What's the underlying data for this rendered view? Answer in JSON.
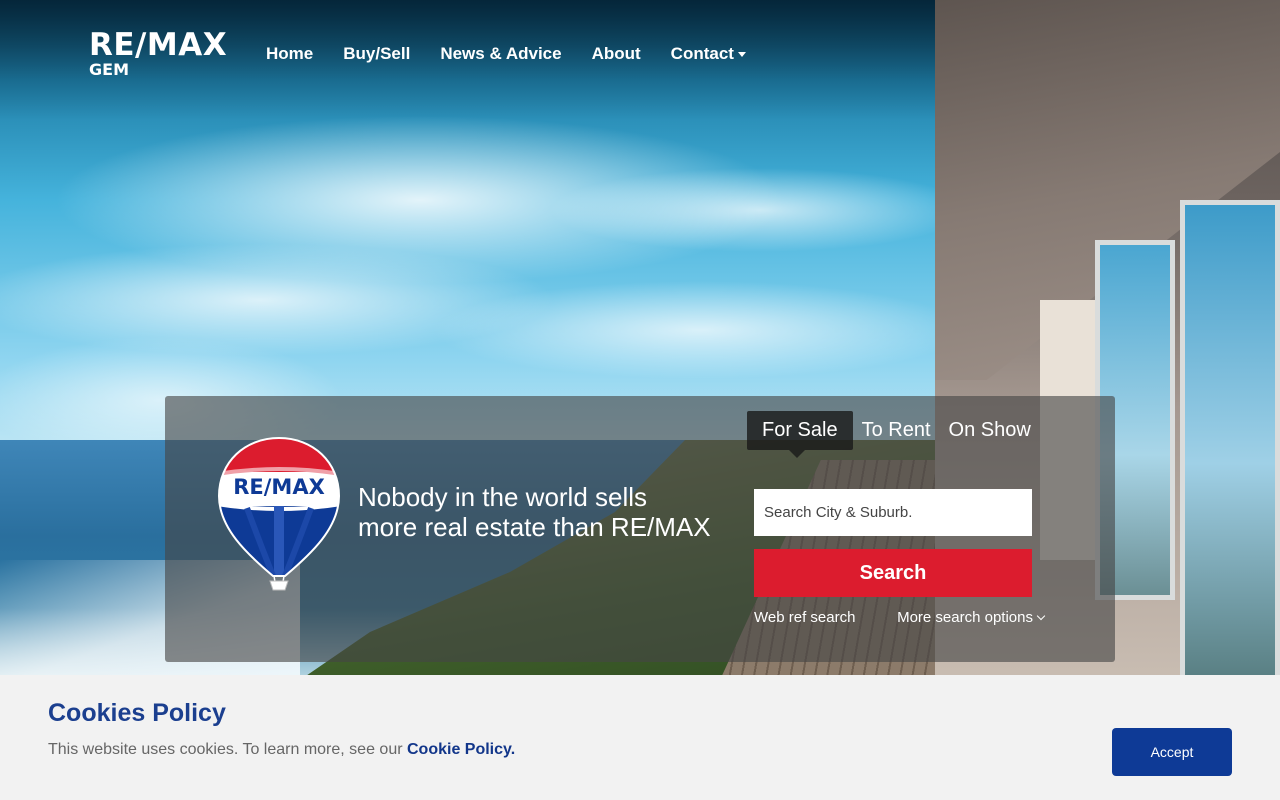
{
  "brand": {
    "logo_main": "RE/MAX",
    "logo_sub": "GEM",
    "balloon_text": "RE/MAX",
    "colors": {
      "red": "#dc1c2e",
      "blue": "#0e3a96",
      "white": "#ffffff"
    }
  },
  "nav": {
    "items": [
      {
        "label": "Home"
      },
      {
        "label": "Buy/Sell"
      },
      {
        "label": "News & Advice"
      },
      {
        "label": "About"
      },
      {
        "label": "Contact",
        "has_dropdown": true
      }
    ]
  },
  "hero": {
    "tagline_line1": "Nobody in the world sells",
    "tagline_line2": "more real estate than RE/MAX"
  },
  "search": {
    "tabs": [
      {
        "label": "For Sale",
        "active": true
      },
      {
        "label": "To Rent",
        "active": false
      },
      {
        "label": "On Show",
        "active": false
      }
    ],
    "placeholder": "Search City & Suburb.",
    "value": "",
    "button_label": "Search",
    "web_ref_label": "Web ref search",
    "more_options_label": "More search options"
  },
  "cookie": {
    "title": "Cookies Policy",
    "text": "This website uses cookies. To learn more, see our",
    "link_label": "Cookie Policy.",
    "accept_label": "Accept"
  }
}
